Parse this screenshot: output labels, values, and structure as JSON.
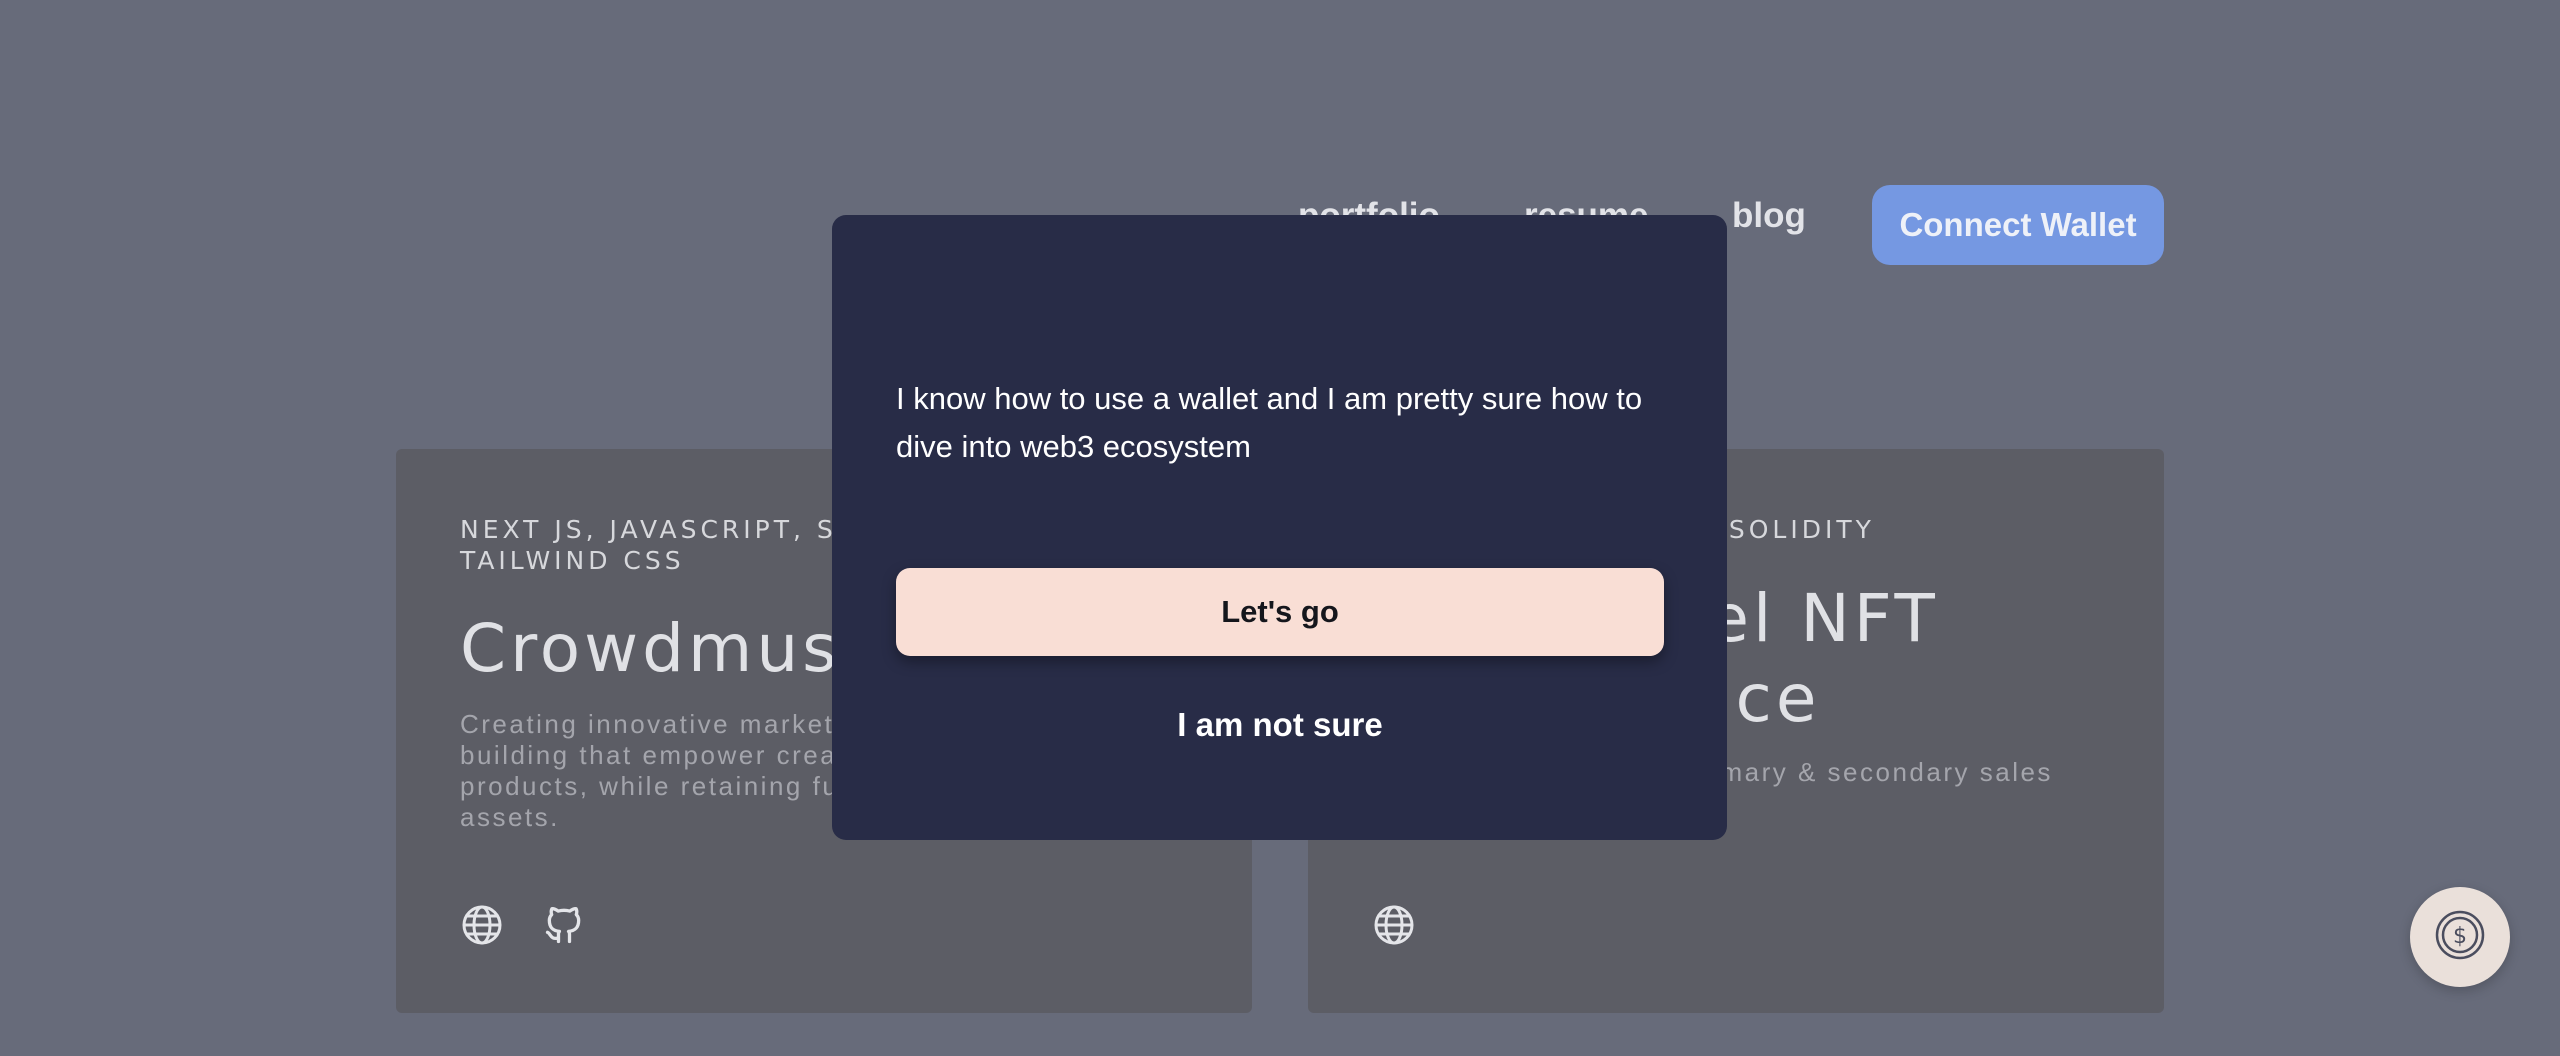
{
  "nav": {
    "links": [
      "portfolio",
      "resume",
      "blog"
    ],
    "connect_label": "Connect Wallet"
  },
  "cards": [
    {
      "tags": "NEXT JS, JAVASCRIPT, SOLIDITY, ETHEREUM, TAILWIND CSS",
      "title": "Crowdmuse",
      "description": "Creating innovative marketplace products. Skilled in building that empower creators to collaborate on products, while retaining full rights of creative assets.",
      "icons": [
        "globe-icon",
        "github-icon"
      ]
    },
    {
      "tags": "NEXT JS, JAVASCRIPT, SOLIDITY",
      "title": "Multi-Level NFT Marketplace",
      "description": "NFT marketplace with primary & secondary sales B2B",
      "icons": [
        "globe-icon"
      ]
    }
  ],
  "modal": {
    "text": "I know how to use a wallet and I am pretty sure how to dive into web3 ecosystem",
    "primary_label": "Let's go",
    "secondary_label": "I am not sure"
  },
  "fab": {
    "icon": "dollar-coin-icon"
  },
  "colors": {
    "background": "#676b7a",
    "modal": "#282c47",
    "accent": "#7598e2",
    "primary_button": "#f9ded5"
  }
}
